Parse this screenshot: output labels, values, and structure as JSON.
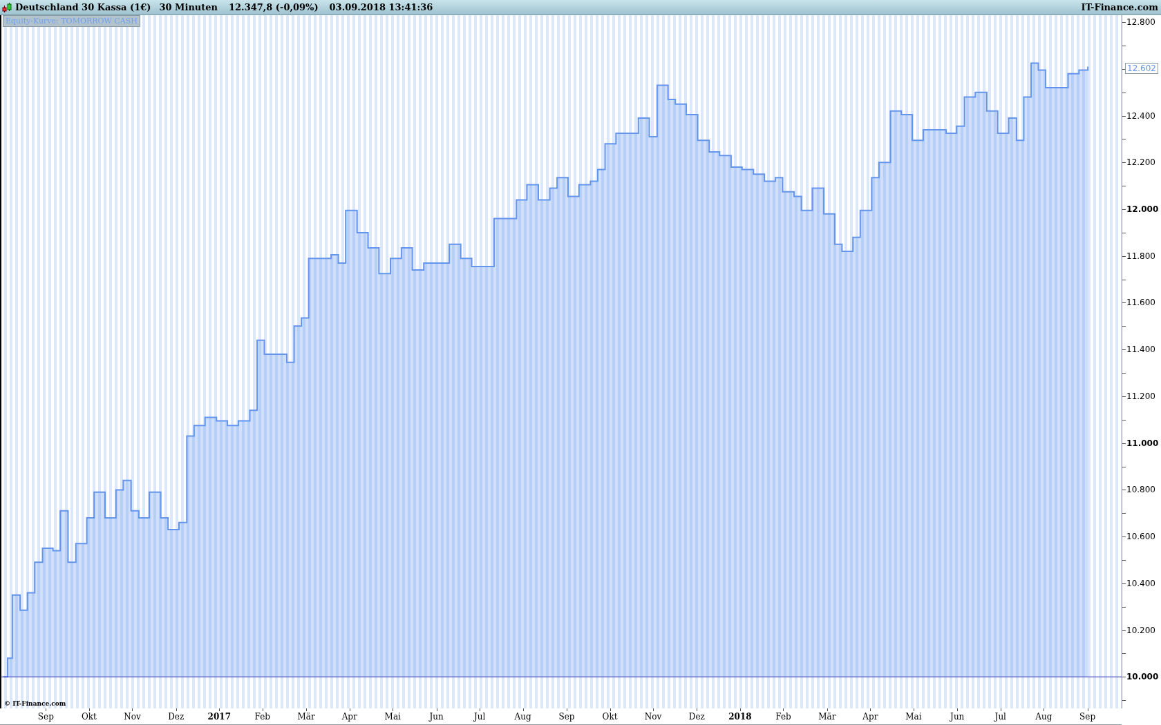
{
  "title_bar": {
    "instrument": "Deutschland 30 Kassa (1€)",
    "interval": "30 Minuten",
    "quote": "12.347,8 (-0,09%)",
    "datetime": "03.09.2018 13:41:36",
    "brand": "IT-Finance.com"
  },
  "chart": {
    "copyright": "© IT-Finance.com",
    "last_value": "12.602",
    "chart_data": {
      "type": "area",
      "x": [
        2016.583,
        2016.591,
        2016.6,
        2016.615,
        2016.629,
        2016.643,
        2016.658,
        2016.678,
        2016.692,
        2016.707,
        2016.722,
        2016.743,
        2016.757,
        2016.778,
        2016.799,
        2016.813,
        2016.828,
        2016.843,
        2016.863,
        2016.885,
        2016.899,
        2016.92,
        2016.935,
        2016.949,
        2016.97,
        2016.992,
        2017.013,
        2017.034,
        2017.056,
        2017.07,
        2017.084,
        2017.105,
        2017.127,
        2017.141,
        2017.155,
        2017.169,
        2017.191,
        2017.212,
        2017.226,
        2017.24,
        2017.262,
        2017.283,
        2017.304,
        2017.326,
        2017.347,
        2017.368,
        2017.39,
        2017.418,
        2017.439,
        2017.461,
        2017.482,
        2017.503,
        2017.525,
        2017.546,
        2017.568,
        2017.588,
        2017.61,
        2017.632,
        2017.646,
        2017.667,
        2017.688,
        2017.71,
        2017.724,
        2017.738,
        2017.759,
        2017.781,
        2017.802,
        2017.823,
        2017.838,
        2017.859,
        2017.873,
        2017.894,
        2017.916,
        2017.938,
        2017.958,
        2017.98,
        2018.001,
        2018.023,
        2018.044,
        2018.065,
        2018.079,
        2018.101,
        2018.115,
        2018.136,
        2018.158,
        2018.179,
        2018.193,
        2018.214,
        2018.228,
        2018.25,
        2018.264,
        2018.286,
        2018.307,
        2018.328,
        2018.349,
        2018.371,
        2018.393,
        2018.413,
        2018.428,
        2018.449,
        2018.471,
        2018.492,
        2018.513,
        2018.528,
        2018.542,
        2018.556,
        2018.57,
        2018.584,
        2018.606,
        2018.627,
        2018.648,
        2018.665
      ],
      "series": [
        {
          "name": "Equity-Kurve: TOMORROW CASH",
          "color": "#6495ed",
          "values": [
            10000,
            10080,
            10350,
            10285,
            10360,
            10490,
            10550,
            10540,
            10710,
            10490,
            10570,
            10680,
            10790,
            10680,
            10800,
            10840,
            10710,
            10680,
            10790,
            10680,
            10630,
            10660,
            11030,
            11075,
            11110,
            11095,
            11075,
            11095,
            11140,
            11440,
            11380,
            11380,
            11345,
            11500,
            11535,
            11790,
            11790,
            11805,
            11770,
            11995,
            11900,
            11835,
            11725,
            11790,
            11835,
            11740,
            11770,
            11770,
            11850,
            11790,
            11755,
            11755,
            11960,
            11960,
            12040,
            12105,
            12040,
            12090,
            12135,
            12055,
            12105,
            12120,
            12170,
            12280,
            12325,
            12325,
            12390,
            12310,
            12530,
            12470,
            12450,
            12405,
            12295,
            12245,
            12230,
            12180,
            12170,
            12150,
            12120,
            12135,
            12075,
            12055,
            11995,
            12090,
            11980,
            11850,
            11820,
            11880,
            11995,
            12135,
            12200,
            12420,
            12405,
            12295,
            12340,
            12340,
            12325,
            12355,
            12480,
            12500,
            12420,
            12325,
            12390,
            12295,
            12480,
            12625,
            12595,
            12520,
            12520,
            12580,
            12595,
            12610
          ]
        }
      ],
      "xlim": [
        2016.579,
        2018.7325
      ],
      "ylim": [
        9865,
        12830
      ],
      "ref_lines": [
        {
          "axis": "y",
          "value": 10000,
          "color": "#2a2ab0"
        }
      ],
      "xticks": [
        {
          "value": 2016.667,
          "label": "Sep"
        },
        {
          "value": 2016.75,
          "label": "Okt"
        },
        {
          "value": 2016.833,
          "label": "Nov"
        },
        {
          "value": 2016.917,
          "label": "Dez"
        },
        2017,
        {
          "value": 2017.083,
          "label": "Feb"
        },
        {
          "value": 2017.167,
          "label": "Mär"
        },
        {
          "value": 2017.25,
          "label": "Apr"
        },
        {
          "value": 2017.333,
          "label": "Mai"
        },
        {
          "value": 2017.417,
          "label": "Jun"
        },
        {
          "value": 2017.5,
          "label": "Jul"
        },
        {
          "value": 2017.583,
          "label": "Aug"
        },
        {
          "value": 2017.667,
          "label": "Sep"
        },
        {
          "value": 2017.75,
          "label": "Okt"
        },
        {
          "value": 2017.833,
          "label": "Nov"
        },
        {
          "value": 2017.917,
          "label": "Dez"
        },
        2018,
        {
          "value": 2018.083,
          "label": "Feb"
        },
        {
          "value": 2018.167,
          "label": "Mär"
        },
        {
          "value": 2018.25,
          "label": "Apr"
        },
        {
          "value": 2018.333,
          "label": "Mai"
        },
        {
          "value": 2018.417,
          "label": "Jun"
        },
        {
          "value": 2018.5,
          "label": "Jul"
        },
        {
          "value": 2018.583,
          "label": "Aug"
        },
        {
          "value": 2018.667,
          "label": "Sep"
        }
      ],
      "yticks": [
        {
          "value": 10000,
          "label": "10.000"
        },
        {
          "value": 10200,
          "label": "10.200"
        },
        {
          "value": 10400,
          "label": "10.400"
        },
        {
          "value": 10600,
          "label": "10.600"
        },
        {
          "value": 10800,
          "label": "10.800"
        },
        {
          "value": 11000,
          "label": "11.000"
        },
        {
          "value": 11200,
          "label": "11.200"
        },
        {
          "value": 11400,
          "label": "11.400"
        },
        {
          "value": 11600,
          "label": "11.600"
        },
        {
          "value": 11800,
          "label": "11.800"
        },
        {
          "value": 12000,
          "label": "12.000"
        },
        {
          "value": 12200,
          "label": "12.200"
        },
        {
          "value": 12400,
          "label": "12.400"
        },
        {
          "value": 12800,
          "label": "12.800"
        }
      ]
    }
  }
}
